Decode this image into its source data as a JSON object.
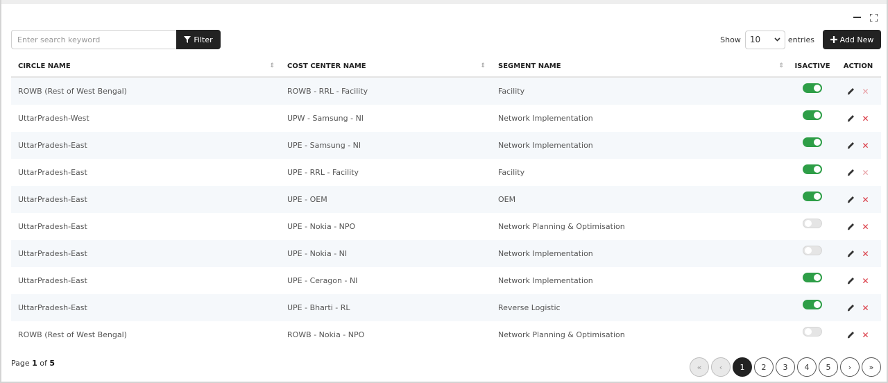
{
  "toolbar": {
    "search_placeholder": "Enter search keyword",
    "filter_label": "Filter",
    "show_label": "Show",
    "entries_value": "10",
    "entries_label": "entries",
    "add_new_label": "Add New"
  },
  "table": {
    "headers": [
      "CIRCLE NAME",
      "COST CENTER NAME",
      "SEGMENT NAME",
      "ISACTIVE",
      "ACTION"
    ],
    "rows": [
      {
        "circle": "ROWB (Rest of West Bengal)",
        "cost_center": "ROWB - RRL - Facility",
        "segment": "Facility",
        "active": true
      },
      {
        "circle": "UttarPradesh-West",
        "cost_center": "UPW - Samsung - NI",
        "segment": "Network Implementation",
        "active": true
      },
      {
        "circle": "UttarPradesh-East",
        "cost_center": "UPE - Samsung - NI",
        "segment": "Network Implementation",
        "active": true
      },
      {
        "circle": "UttarPradesh-East",
        "cost_center": "UPE - RRL - Facility",
        "segment": "Facility",
        "active": true
      },
      {
        "circle": "UttarPradesh-East",
        "cost_center": "UPE - OEM",
        "segment": "OEM",
        "active": true
      },
      {
        "circle": "UttarPradesh-East",
        "cost_center": "UPE - Nokia - NPO",
        "segment": "Network Planning & Optimisation",
        "active": false
      },
      {
        "circle": "UttarPradesh-East",
        "cost_center": "UPE - Nokia - NI",
        "segment": "Network Implementation",
        "active": false
      },
      {
        "circle": "UttarPradesh-East",
        "cost_center": "UPE - Ceragon - NI",
        "segment": "Network Implementation",
        "active": true
      },
      {
        "circle": "UttarPradesh-East",
        "cost_center": "UPE - Bharti - RL",
        "segment": "Reverse Logistic",
        "active": true
      },
      {
        "circle": "ROWB (Rest of West Bengal)",
        "cost_center": "ROWB - Nokia - NPO",
        "segment": "Network Planning & Optimisation",
        "active": false
      }
    ]
  },
  "footer": {
    "page_prefix": "Page",
    "current_page": "1",
    "of_label": "of",
    "total_pages": "5",
    "pages": [
      "1",
      "2",
      "3",
      "4",
      "5"
    ],
    "first_symbol": "«",
    "prev_symbol": "‹",
    "next_symbol": "›",
    "last_symbol": "»"
  },
  "colors": {
    "primary": "#222222",
    "toggle_on": "#2e9e47",
    "toggle_off": "#e5e5e5",
    "delete": "#d9343f",
    "stripe": "#f5f8fb"
  }
}
